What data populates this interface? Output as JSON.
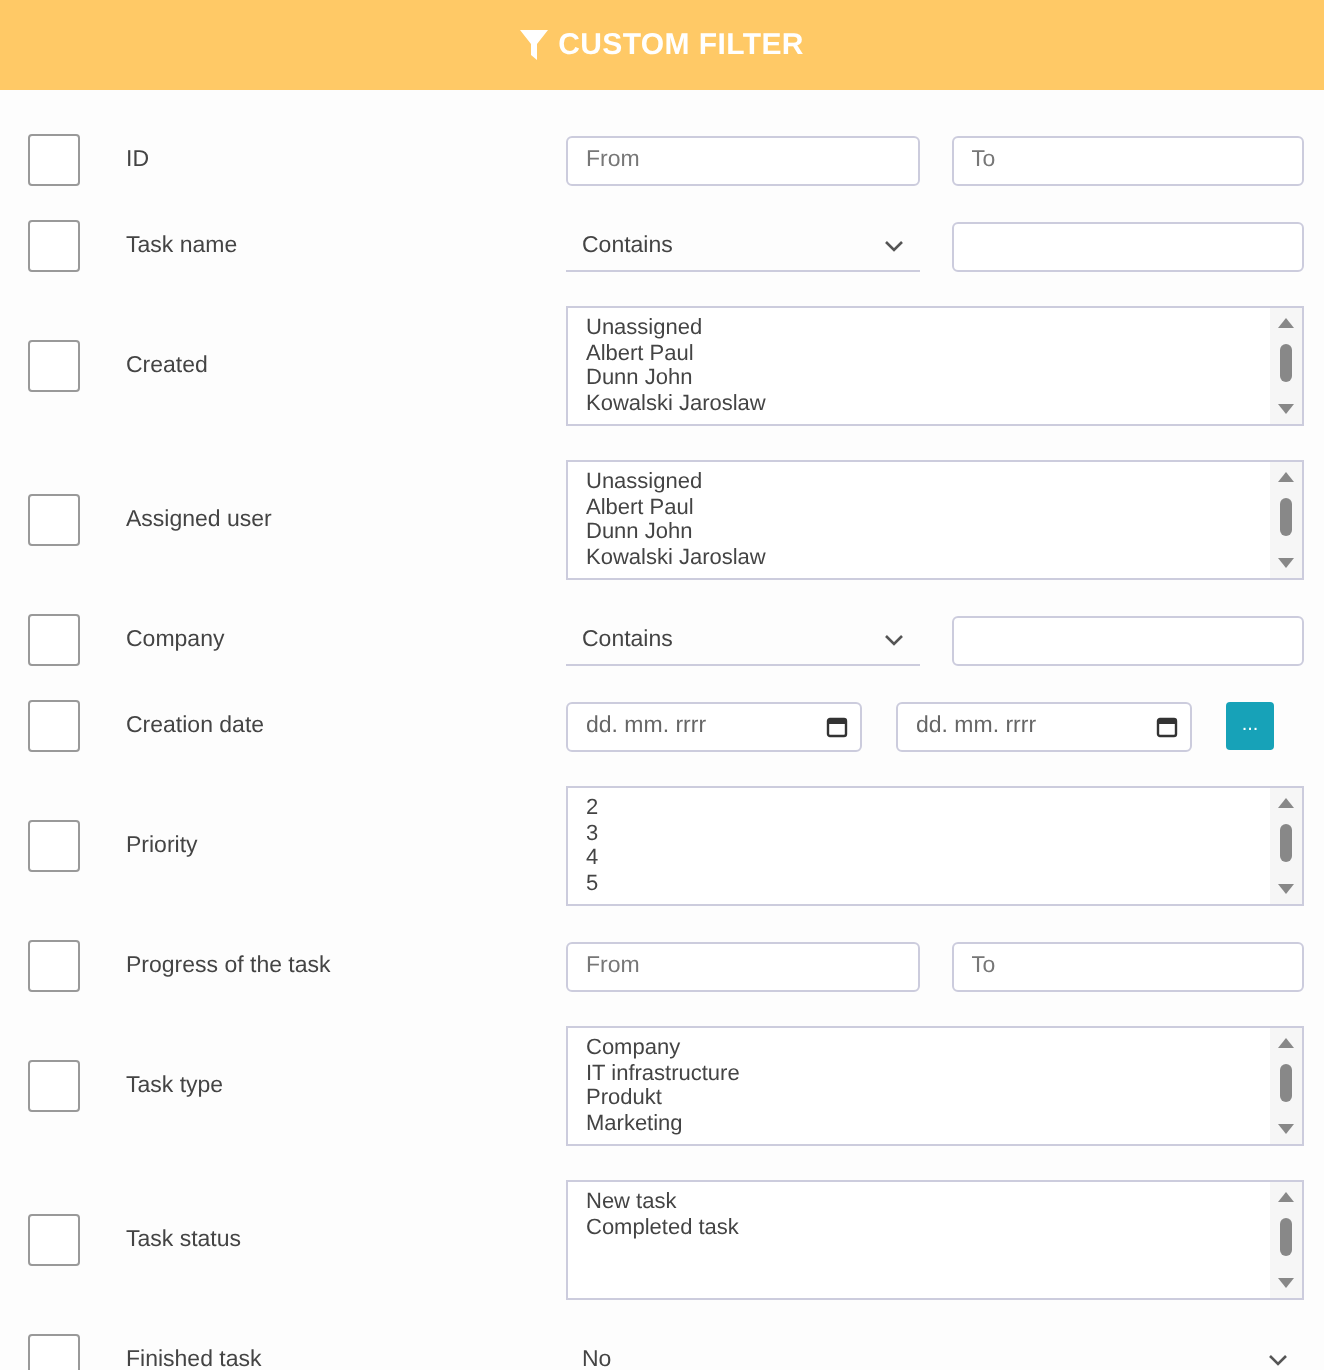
{
  "header": {
    "title": "CUSTOM FILTER"
  },
  "rows": [
    {
      "kind": "range",
      "label": "ID",
      "checked": false,
      "from_placeholder": "From",
      "to_placeholder": "To"
    },
    {
      "kind": "text_select",
      "label": "Task name",
      "checked": false,
      "operator": "Contains"
    },
    {
      "kind": "list",
      "label": "Created",
      "checked": false,
      "options": [
        "Unassigned",
        "Albert Paul",
        "Dunn John",
        "Kowalski Jaroslaw"
      ]
    },
    {
      "kind": "list",
      "label": "Assigned user",
      "checked": false,
      "options": [
        "Unassigned",
        "Albert Paul",
        "Dunn John",
        "Kowalski Jaroslaw"
      ]
    },
    {
      "kind": "text_select",
      "label": "Company",
      "checked": false,
      "operator": "Contains"
    },
    {
      "kind": "date_range",
      "label": "Creation date",
      "checked": false,
      "from_placeholder": "dd. mm. rrrr",
      "to_placeholder": "dd. mm. rrrr",
      "button": "..."
    },
    {
      "kind": "list",
      "label": "Priority",
      "checked": false,
      "options": [
        "2",
        "3",
        "4",
        "5"
      ]
    },
    {
      "kind": "range",
      "label": "Progress of the task",
      "checked": false,
      "from_placeholder": "From",
      "to_placeholder": "To"
    },
    {
      "kind": "list",
      "label": "Task type",
      "checked": false,
      "options": [
        "Company",
        "IT infrastructure",
        "Produkt",
        "Marketing"
      ]
    },
    {
      "kind": "list",
      "label": "Task status",
      "checked": false,
      "options": [
        "New task",
        "Completed task"
      ]
    },
    {
      "kind": "select",
      "label": "Finished task",
      "checked": false,
      "value": "No"
    }
  ]
}
